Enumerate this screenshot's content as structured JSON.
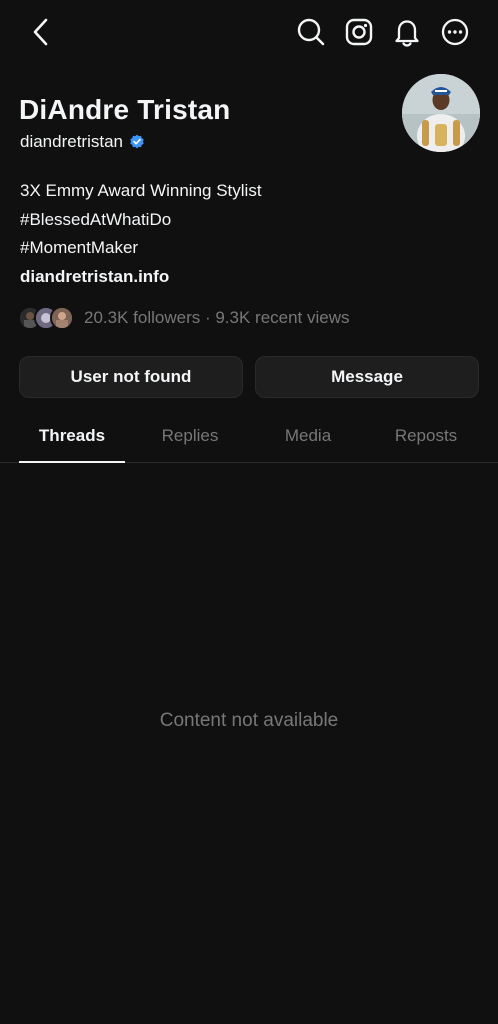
{
  "topbar": {
    "back_icon": "chevron-left-icon",
    "search_icon": "search-icon",
    "instagram_icon": "instagram-icon",
    "notifications_icon": "bell-icon",
    "more_icon": "more-icon"
  },
  "profile": {
    "name": "DiAndre Tristan",
    "handle": "diandretristan",
    "verified": true,
    "bio_lines": [
      "3X Emmy Award Winning Stylist",
      "#BlessedAtWhatiDo",
      "#MomentMaker"
    ],
    "link": "diandretristan.info",
    "followers_text": "20.3K followers · 9.3K recent views"
  },
  "actions": {
    "primary_label": "User not found",
    "secondary_label": "Message"
  },
  "tabs": [
    {
      "label": "Threads",
      "active": true
    },
    {
      "label": "Replies",
      "active": false
    },
    {
      "label": "Media",
      "active": false
    },
    {
      "label": "Reposts",
      "active": false
    }
  ],
  "content": {
    "empty_message": "Content not available"
  },
  "colors": {
    "background": "#101010",
    "text_primary": "#f3f5f7",
    "text_secondary": "#777777",
    "verified_blue": "#3d95f5",
    "button_bg": "#1e1e1e"
  }
}
